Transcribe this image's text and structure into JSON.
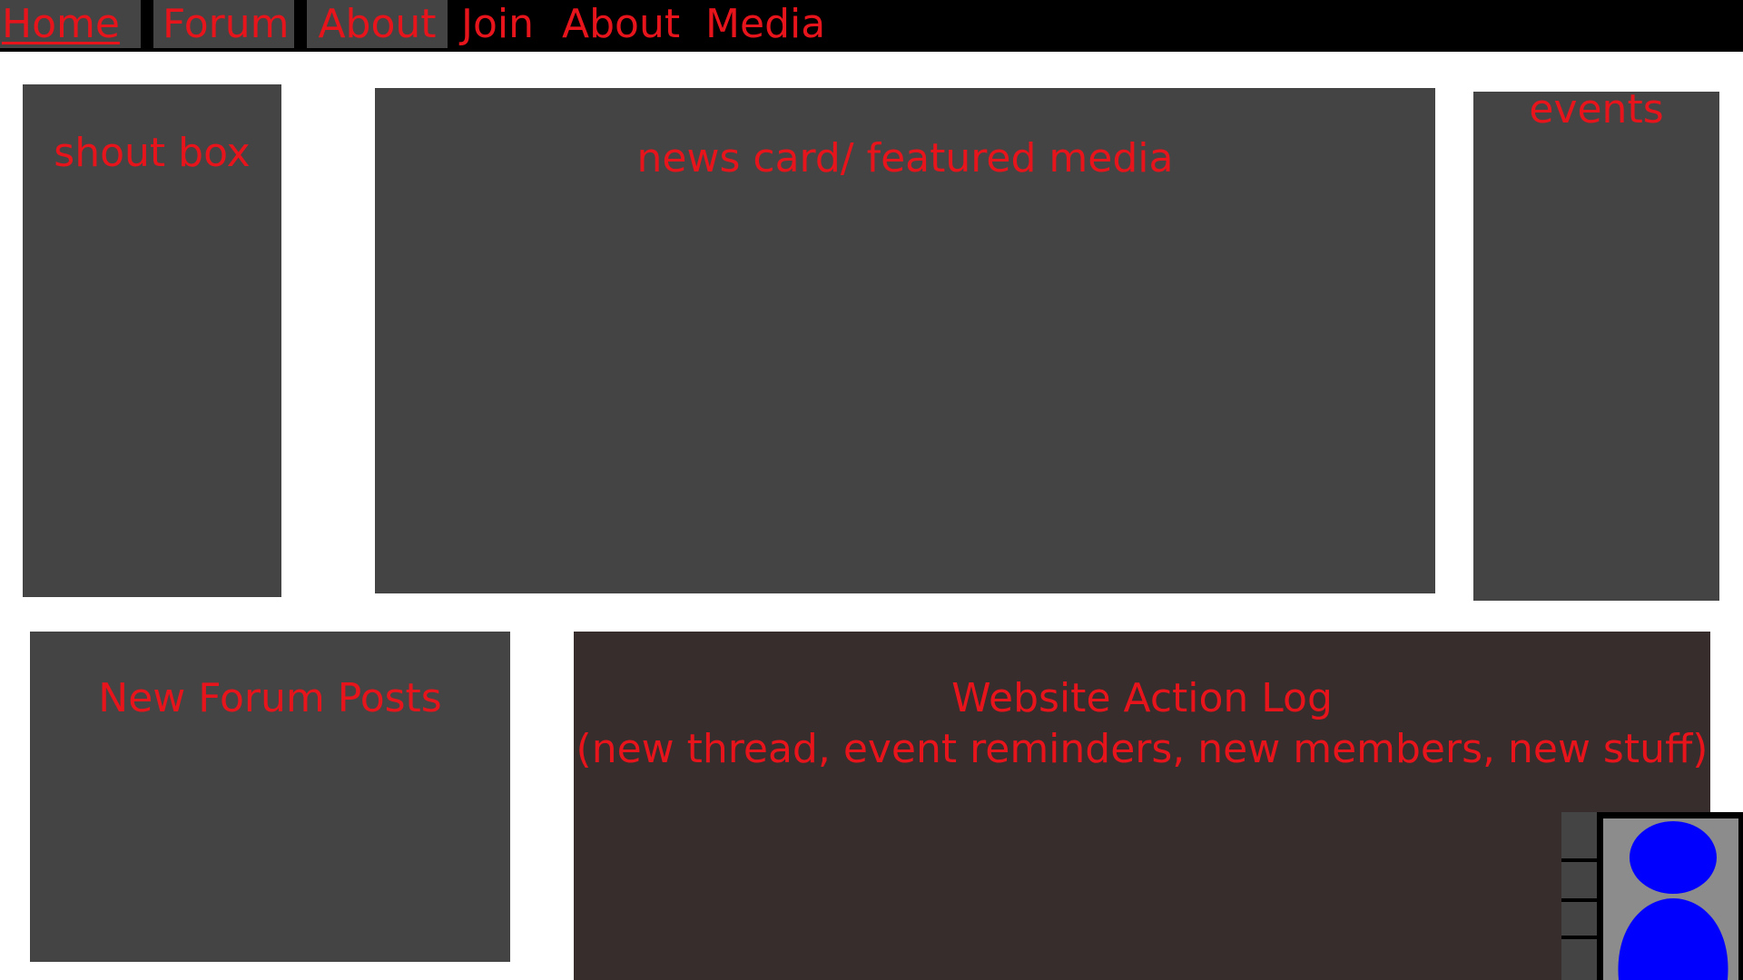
{
  "nav": {
    "home": "Home",
    "forum": "Forum",
    "about": "About",
    "join": "Join",
    "about_media": "About  Media"
  },
  "panels": {
    "shout_box": "shout box",
    "news_card": "news card/ featured media",
    "events": "events",
    "new_forum_posts": "New Forum Posts",
    "action_log_title": "Website Action Log",
    "action_log_subtitle": "(new thread, event reminders, new members, new stuff)"
  },
  "colors": {
    "nav_bg": "#000000",
    "text_accent": "#e8141c",
    "panel_bg": "#444444",
    "action_log_bg": "#362d2c",
    "avatar": "#0000ff",
    "avatar_bg": "#8c8c8c"
  },
  "icons": {
    "avatar": "user-silhouette-icon"
  }
}
